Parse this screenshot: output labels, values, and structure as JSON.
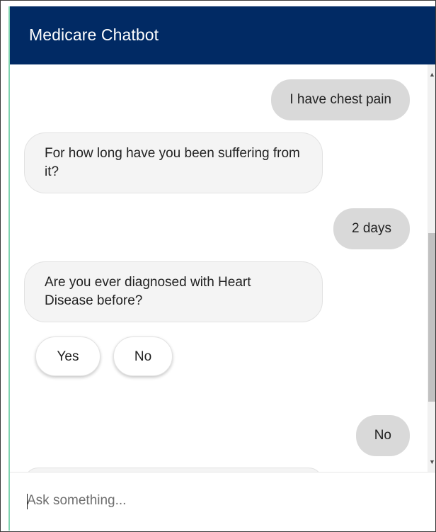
{
  "header": {
    "title": "Medicare Chatbot"
  },
  "messages": [
    {
      "sender": "user",
      "text": "I have chest pain"
    },
    {
      "sender": "bot",
      "text": "For how long have you been suffering from it?"
    },
    {
      "sender": "user",
      "text": "2 days"
    },
    {
      "sender": "bot",
      "text": "Are you ever diagnosed with Heart Disease before?"
    },
    {
      "sender": "user",
      "text": "No"
    }
  ],
  "quick_replies": {
    "yes_label": "Yes",
    "no_label": "No"
  },
  "scrollbar": {
    "up_glyph": "▲",
    "down_glyph": "▼"
  },
  "input": {
    "placeholder": "Ask something...",
    "value": ""
  },
  "colors": {
    "header_bg": "#012a64",
    "user_bubble": "#d9d9d9",
    "bot_bubble": "#f4f4f4",
    "accent_edge": "#7fd3b0"
  }
}
